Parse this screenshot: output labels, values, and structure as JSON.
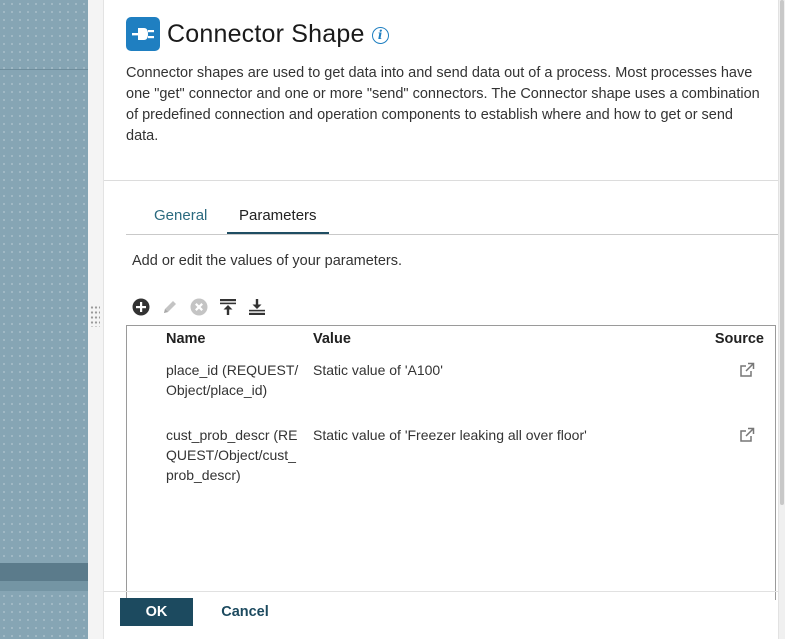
{
  "panel": {
    "title": "Connector Shape",
    "title_icon": "connector-plug-icon",
    "info_icon": "info-icon",
    "description": "Connector shapes are used to get data into and send data out of a process. Most processes have one \"get\" connector and one or more \"send\" connectors. The Connector shape uses a combination of predefined connection and operation components to establish where and how to get or send data."
  },
  "tabs": [
    {
      "label": "General",
      "active": false
    },
    {
      "label": "Parameters",
      "active": true
    }
  ],
  "parameters": {
    "instruction": "Add or edit the values of your parameters.",
    "toolbar": [
      "add-icon",
      "edit-icon",
      "delete-icon",
      "move-to-top-icon",
      "move-to-bottom-icon"
    ],
    "columns": {
      "name": "Name",
      "value": "Value",
      "source": "Source"
    },
    "rows": [
      {
        "name": "place_id (REQUEST/Object/place_id)",
        "value": "Static value of 'A100'"
      },
      {
        "name": "cust_prob_descr (REQUEST/Object/cust_prob_descr)",
        "value": "Static value of 'Freezer leaking all over floor'"
      }
    ]
  },
  "footer": {
    "ok_label": "OK",
    "cancel_label": "Cancel"
  },
  "colors": {
    "accent": "#1f7fc1",
    "primary_button": "#1c4a5f",
    "canvas": "#86a5b4"
  }
}
